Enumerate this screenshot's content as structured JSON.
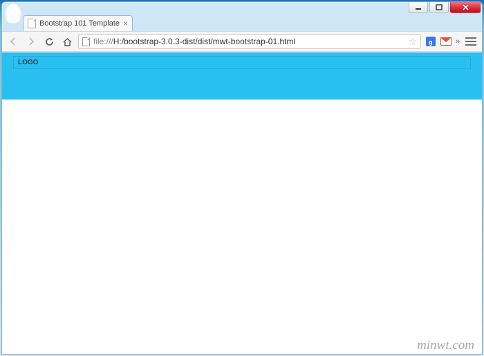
{
  "window": {
    "min_tooltip": "Minimize",
    "max_tooltip": "Maximize",
    "close_tooltip": "Close"
  },
  "tab": {
    "title": "Bootstrap 101 Template"
  },
  "toolbar": {
    "url_prefix": "file:///",
    "url_path": "H:/bootstrap-3.0.3-dist/dist/mwt-bootstrap-01.html",
    "google_icon_label": "g",
    "overflow_label": "»"
  },
  "page": {
    "logo_text": "LOGO"
  },
  "watermark": "minwt.com"
}
